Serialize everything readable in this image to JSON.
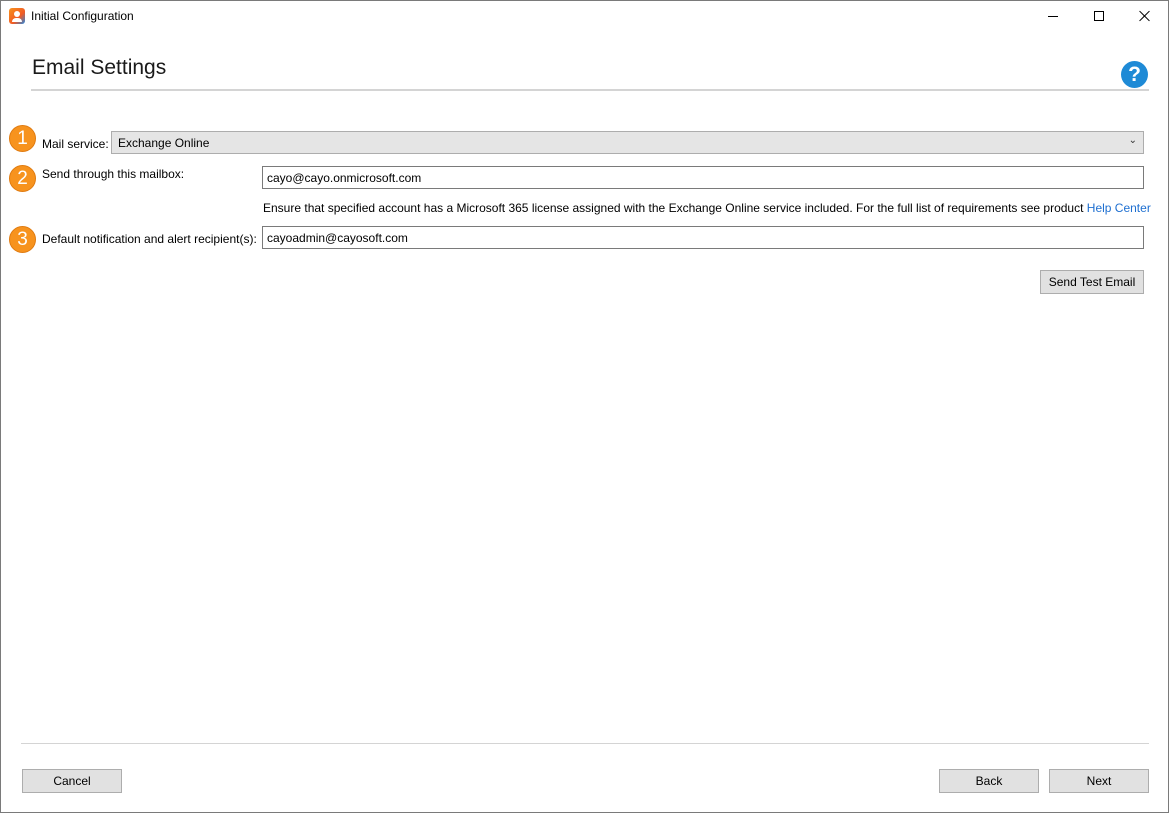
{
  "window": {
    "title": "Initial Configuration"
  },
  "page": {
    "title": "Email Settings"
  },
  "steps": [
    {
      "number": "1",
      "label": "Mail service:"
    },
    {
      "number": "2",
      "label": "Send through this mailbox:"
    },
    {
      "number": "3",
      "label": "Default notification and alert recipient(s):"
    }
  ],
  "mail_service": {
    "selected": "Exchange Online"
  },
  "mailbox": {
    "value": "cayo@cayo.onmicrosoft.com",
    "hint": "Ensure that specified account has a Microsoft 365 license assigned with the Exchange Online service included. For the full list of requirements see product ",
    "hint_link": "Help Center"
  },
  "recipients": {
    "value": "cayoadmin@cayosoft.com"
  },
  "buttons": {
    "send_test": "Send Test Email",
    "cancel": "Cancel",
    "back": "Back",
    "next": "Next"
  },
  "colors": {
    "accent_orange": "#f7931e",
    "help_blue": "#1e8ad6",
    "link_blue": "#1e6fd0"
  },
  "icons": {
    "help": "?",
    "dropdown": "⌄"
  }
}
